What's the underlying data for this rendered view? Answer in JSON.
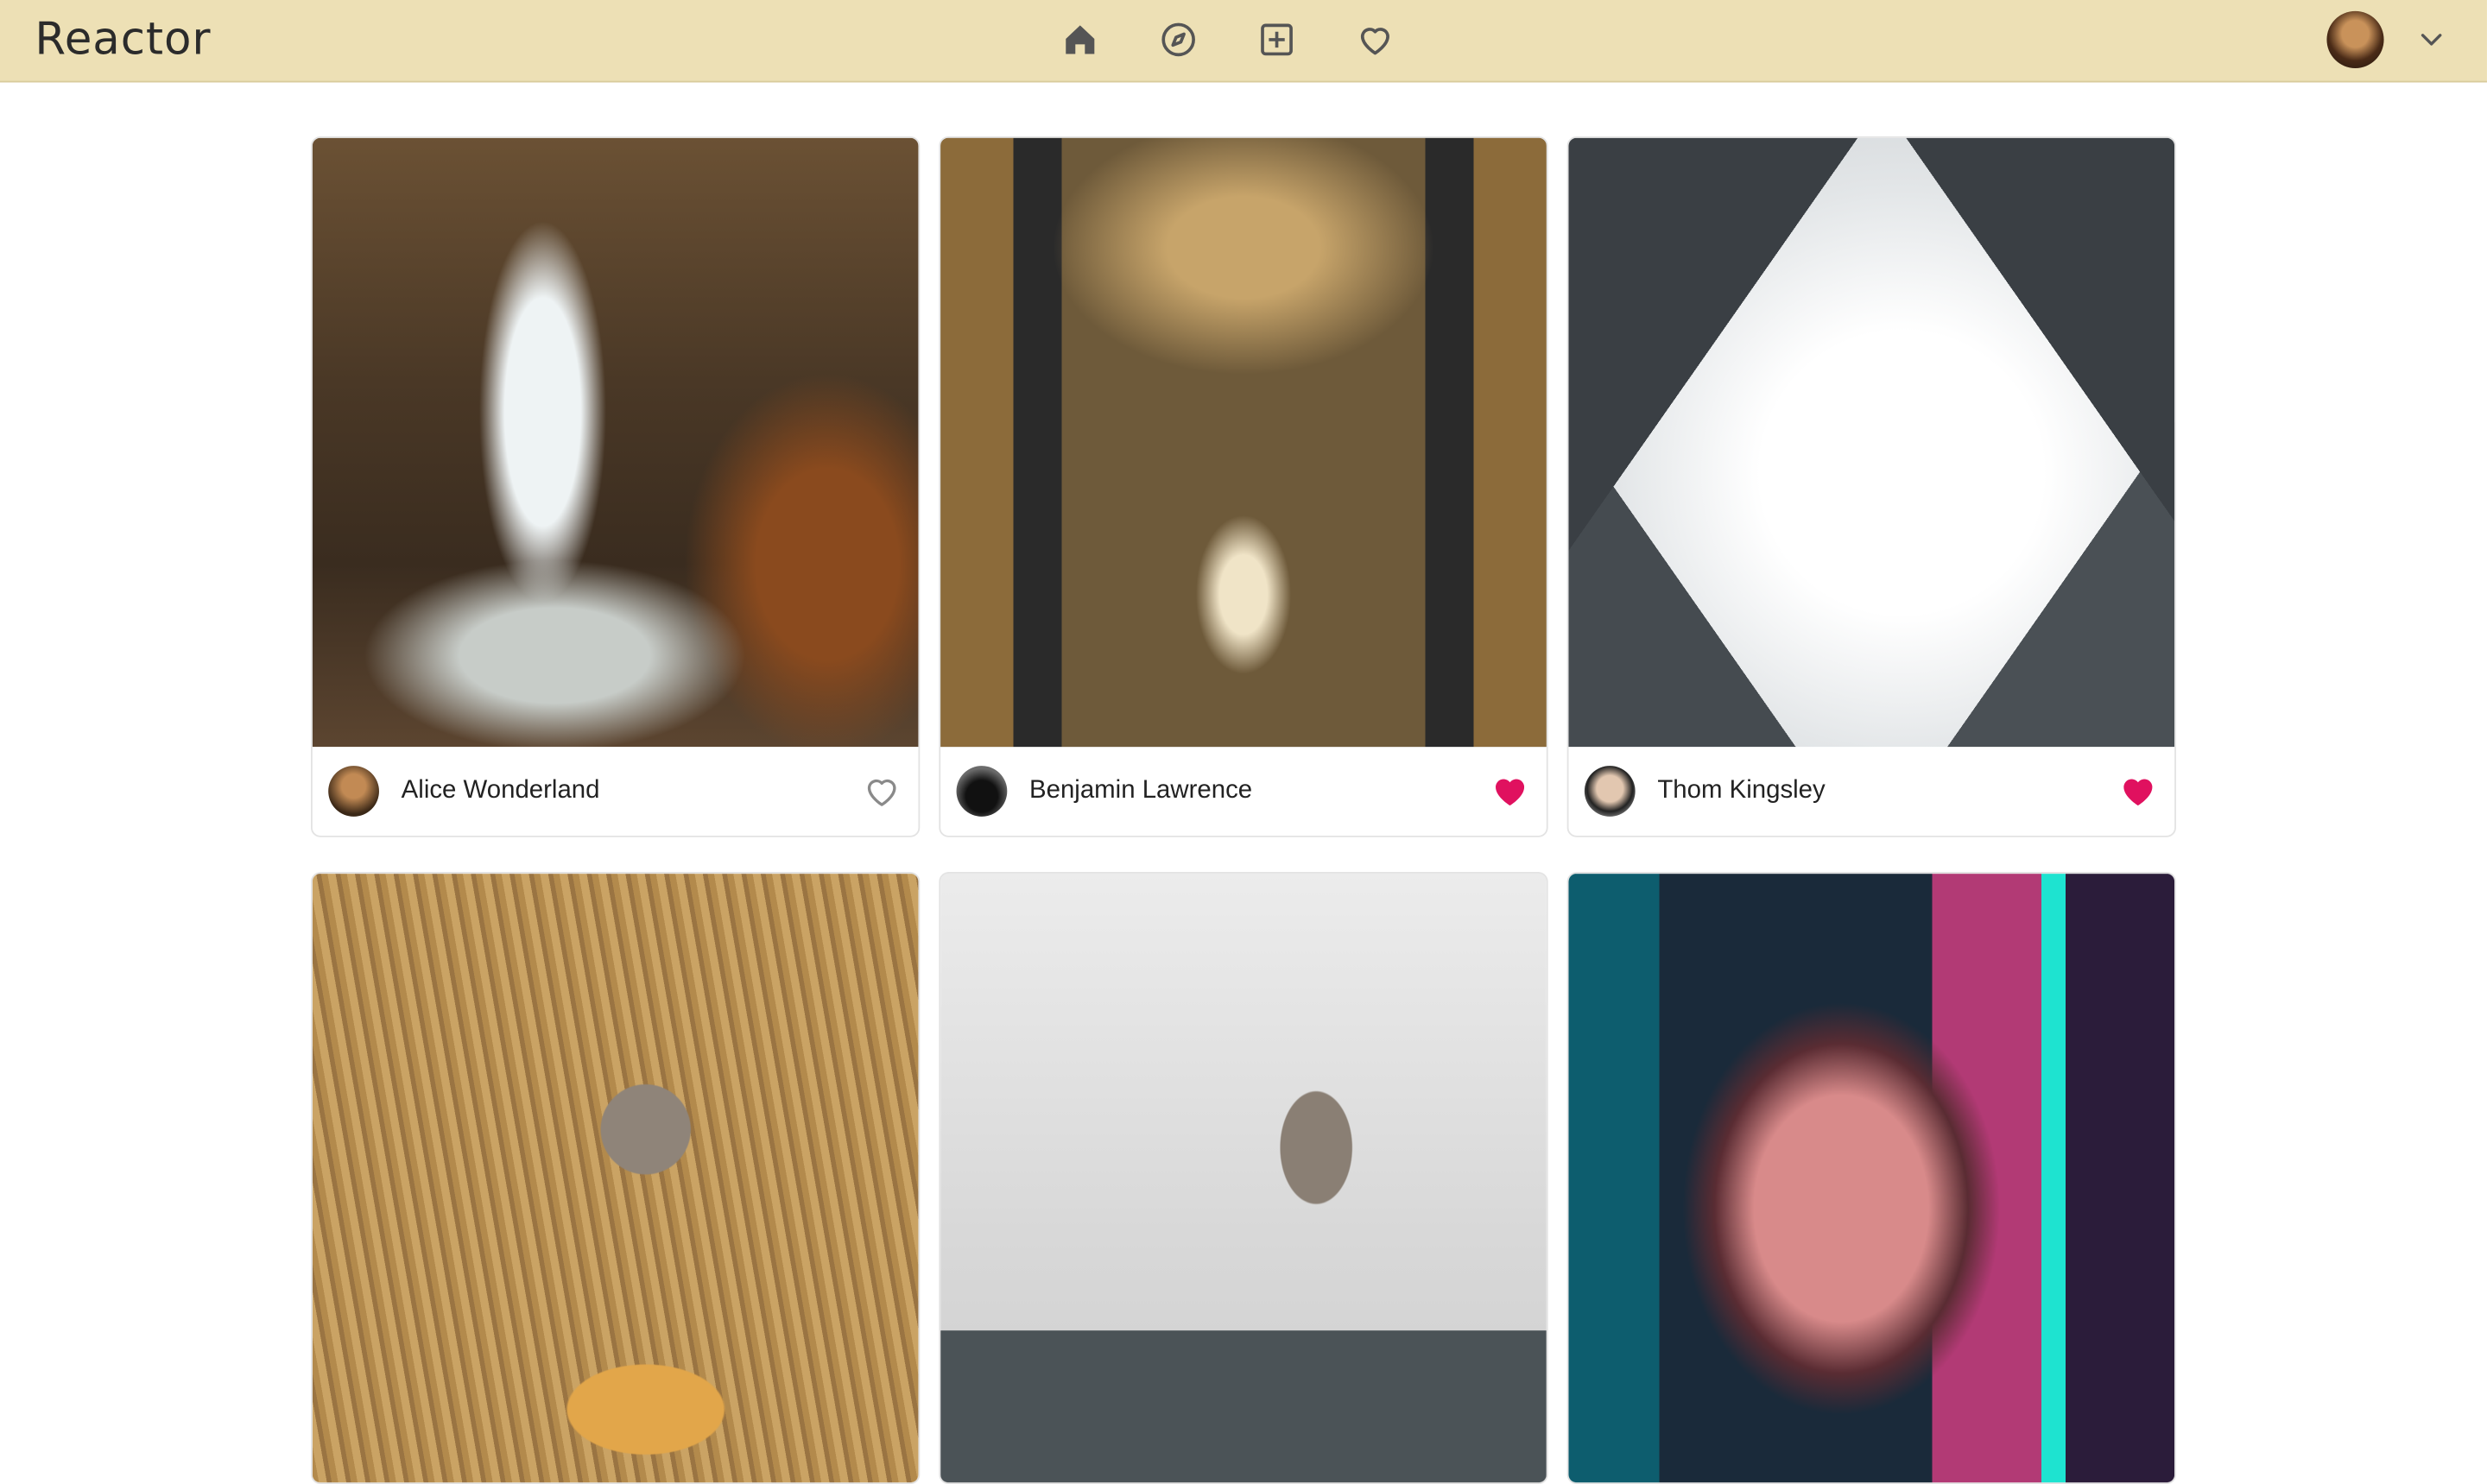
{
  "app": {
    "title": "Reactor"
  },
  "nav": {
    "items": [
      {
        "name": "home",
        "icon": "home-icon"
      },
      {
        "name": "explore",
        "icon": "compass-icon"
      },
      {
        "name": "new-post",
        "icon": "plus-square-icon"
      },
      {
        "name": "activity",
        "icon": "heart-icon"
      }
    ]
  },
  "account": {
    "avatar_icon": "user-avatar",
    "menu_icon": "chevron-down-icon"
  },
  "colors": {
    "header_bg": "#ede0b5",
    "like_active": "#e0115f",
    "like_inactive": "#8a8a8a"
  },
  "posts": [
    {
      "author": "Alice Wonderland",
      "photo": "waterfall",
      "liked": false
    },
    {
      "author": "Benjamin Lawrence",
      "photo": "church-interior",
      "liked": true
    },
    {
      "author": "Thom Kingsley",
      "photo": "skyscrapers",
      "liked": true
    },
    {
      "author": "",
      "photo": "wheat-field-hat",
      "liked": false
    },
    {
      "author": "",
      "photo": "monkey-fog",
      "liked": false
    },
    {
      "author": "",
      "photo": "neon-portrait",
      "liked": false
    }
  ]
}
